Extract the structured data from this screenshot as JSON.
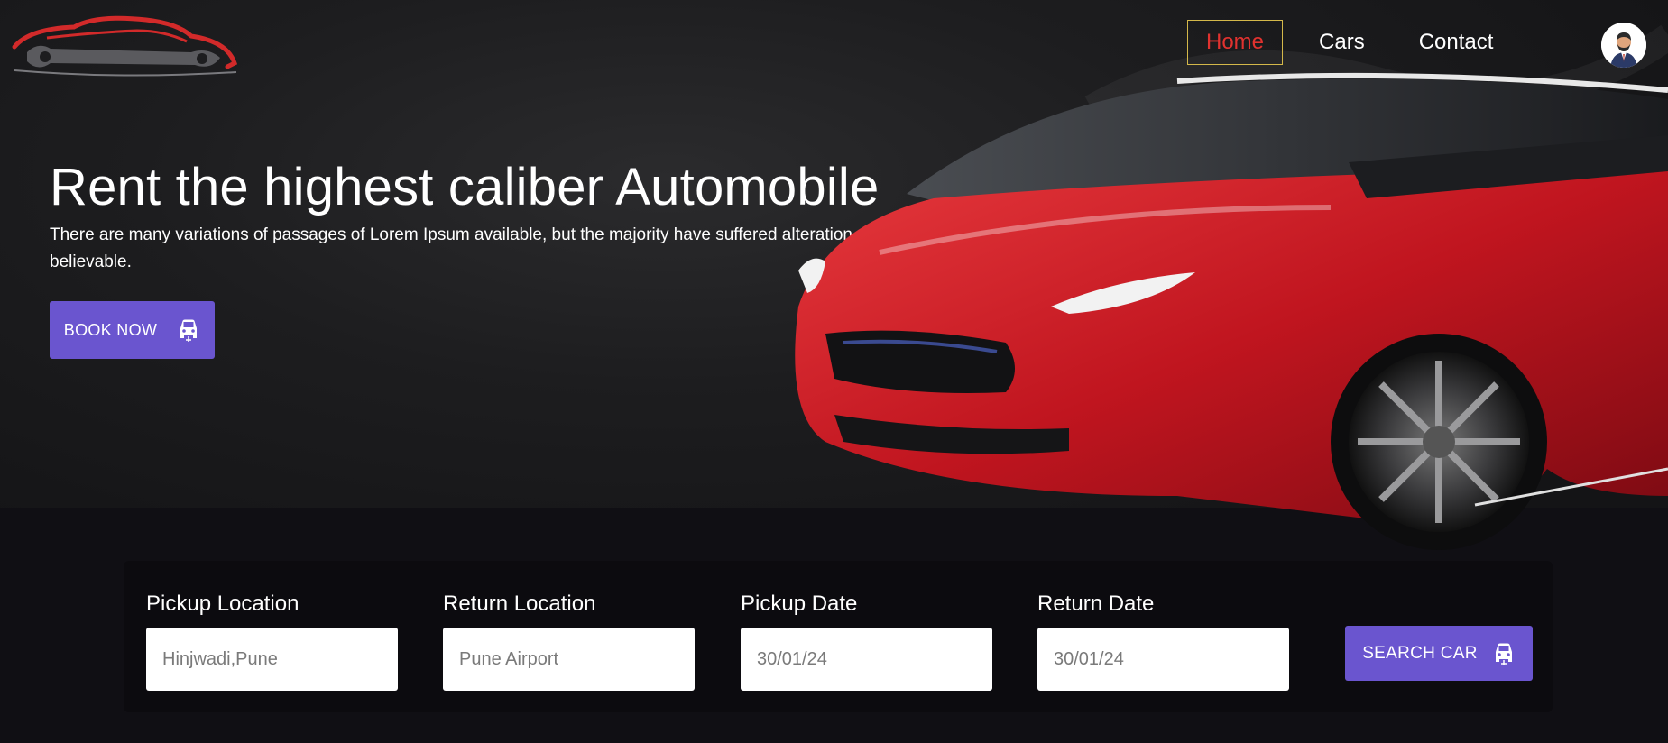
{
  "brand": {
    "logo_icon": "car-wrench-logo",
    "accent_color": "#e1322f"
  },
  "nav": {
    "items": [
      {
        "label": "Home",
        "active": true
      },
      {
        "label": "Cars",
        "active": false
      },
      {
        "label": "Contact",
        "active": false
      }
    ],
    "avatar_icon": "user-avatar-icon"
  },
  "hero": {
    "title": "Rent the highest caliber Automobile",
    "subtitle": "There are many variations of passages of Lorem Ipsum available, but the majority have suffered alteration slightly believable.",
    "book_button": {
      "label": "BOOK NOW",
      "icon": "car-front-icon"
    },
    "button_color": "#6a55cf"
  },
  "search": {
    "fields": [
      {
        "label": "Pickup Location",
        "value": "Hinjwadi,Pune"
      },
      {
        "label": "Return Location",
        "value": "Pune Airport"
      },
      {
        "label": "Pickup Date",
        "value": "30/01/24"
      },
      {
        "label": "Return Date",
        "value": "30/01/24"
      }
    ],
    "search_button": {
      "label": "SEARCH CAR",
      "icon": "car-front-icon"
    }
  }
}
